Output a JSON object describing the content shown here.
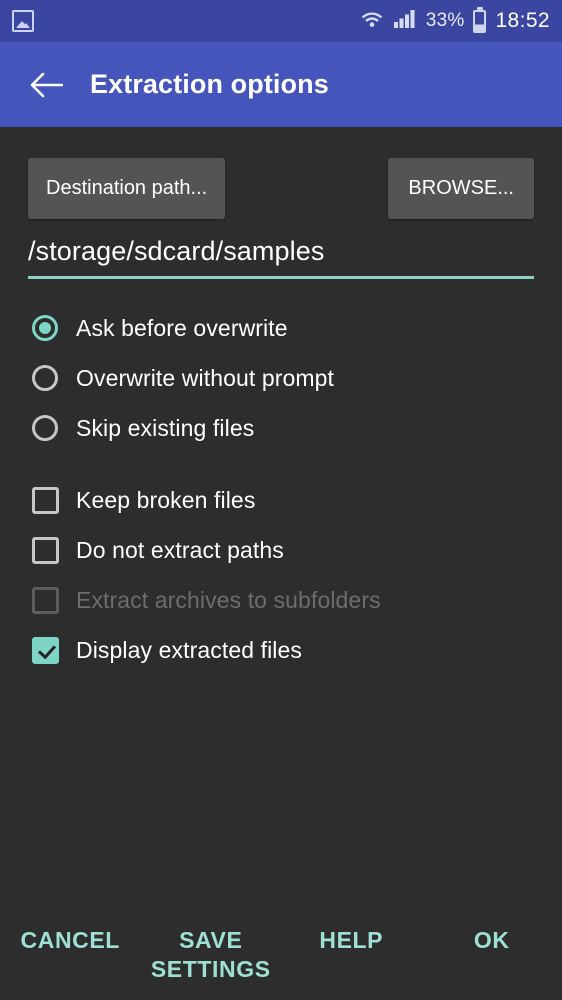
{
  "status_bar": {
    "left_icon": "gallery-icon",
    "wifi_icon": "wifi-icon",
    "signal_icon": "cellular-signal-icon",
    "battery_percent": "33%",
    "battery_icon": "battery-icon",
    "time": "18:52",
    "background_color": "#3a46a0"
  },
  "app_bar": {
    "back_icon": "back-arrow-icon",
    "title": "Extraction options",
    "background_color": "#4555bc"
  },
  "destination": {
    "path_button_label": "Destination path...",
    "browse_button_label": "BROWSE...",
    "path_value": "/storage/sdcard/samples",
    "underline_color": "#8ccfc3"
  },
  "overwrite_options": {
    "selected_index": 0,
    "items": [
      {
        "label": "Ask before overwrite",
        "checked": true
      },
      {
        "label": "Overwrite without prompt",
        "checked": false
      },
      {
        "label": "Skip existing files",
        "checked": false
      }
    ]
  },
  "checkbox_options": {
    "items": [
      {
        "label": "Keep broken files",
        "checked": false,
        "disabled": false
      },
      {
        "label": "Do not extract paths",
        "checked": false,
        "disabled": false
      },
      {
        "label": "Extract archives to subfolders",
        "checked": false,
        "disabled": true
      },
      {
        "label": "Display extracted files",
        "checked": true,
        "disabled": false
      }
    ]
  },
  "actions": {
    "cancel": "CANCEL",
    "save_settings_line1": "SAVE",
    "save_settings_line2": "SETTINGS",
    "help": "HELP",
    "ok": "OK",
    "accent_color": "#9fe0d5"
  },
  "theme": {
    "accent": "#7ed5c6",
    "background": "#2d2d2d",
    "button_background": "#545454"
  }
}
